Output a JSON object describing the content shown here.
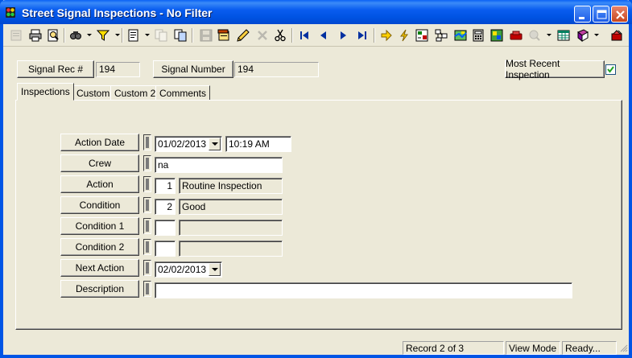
{
  "window": {
    "title": "Street Signal Inspections - No Filter"
  },
  "toolbar": {
    "icons": [
      "blank-form-icon",
      "print-icon",
      "print-preview-icon",
      "find-icon",
      "filter-icon",
      "new-record-icon",
      "copy-record-icon",
      "paste-record-icon",
      "save-icon",
      "notes-icon",
      "edit-icon",
      "delete-icon",
      "cut-icon",
      "first-record-icon",
      "previous-record-icon",
      "next-record-icon",
      "last-record-icon",
      "goto-icon",
      "quick-action-icon",
      "reports-icon",
      "link-icon",
      "map-icon",
      "calculator-icon",
      "map-locate-icon",
      "work-order-icon",
      "query-icon",
      "spreadsheet-icon",
      "book-icon",
      "exit-icon"
    ]
  },
  "header": {
    "rec_label": "Signal Rec #",
    "rec_value": "194",
    "number_label": "Signal Number",
    "number_value": "194",
    "recent_label": "Most Recent Inspection",
    "recent_checked": true
  },
  "tabs": [
    {
      "label": "Inspections",
      "active": true
    },
    {
      "label": "Custom",
      "active": false
    },
    {
      "label": "Custom 2",
      "active": false
    },
    {
      "label": "Comments",
      "active": false
    }
  ],
  "form": {
    "action_date": {
      "label": "Action Date",
      "date": "01/02/2013",
      "time": "10:19 AM"
    },
    "crew": {
      "label": "Crew",
      "value": "na"
    },
    "action": {
      "label": "Action",
      "code": "1",
      "text": "Routine Inspection"
    },
    "condition": {
      "label": "Condition",
      "code": "2",
      "text": "Good"
    },
    "condition1": {
      "label": "Condition 1",
      "code": "",
      "text": ""
    },
    "condition2": {
      "label": "Condition 2",
      "code": "",
      "text": ""
    },
    "next_action": {
      "label": "Next Action",
      "date": "02/02/2013"
    },
    "description": {
      "label": "Description",
      "value": ""
    }
  },
  "status": {
    "record": "Record 2 of 3",
    "mode": "View Mode",
    "state": "Ready..."
  }
}
